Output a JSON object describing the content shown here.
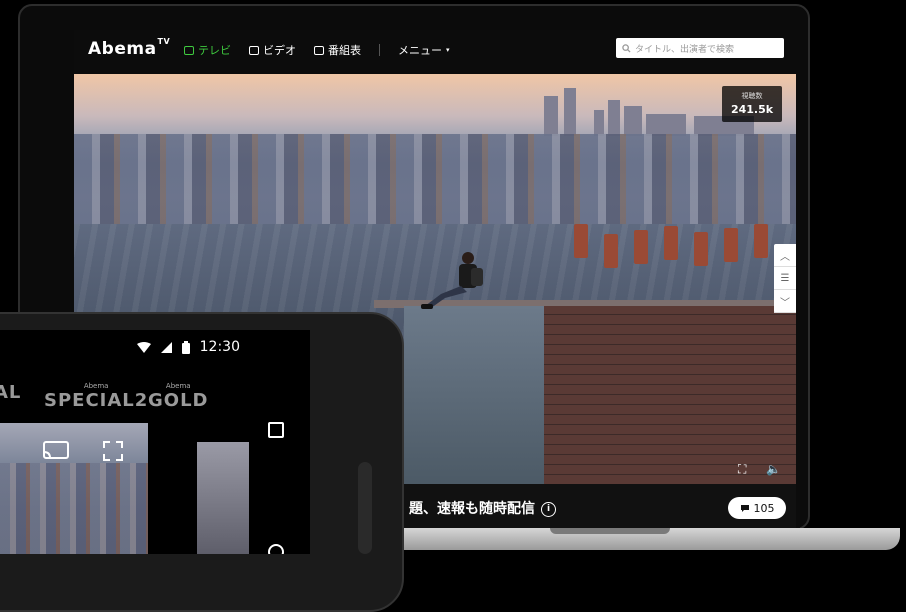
{
  "app": {
    "logo_text": "Abema",
    "logo_sup": "TV"
  },
  "nav": {
    "items": [
      {
        "label": "テレビ",
        "icon": "tv-icon",
        "active": true
      },
      {
        "label": "ビデオ",
        "icon": "film-icon",
        "active": false
      },
      {
        "label": "番組表",
        "icon": "calendar-icon",
        "active": false
      }
    ],
    "menu_label": "メニュー"
  },
  "search": {
    "placeholder": "タイトル、出演者で検索"
  },
  "player": {
    "viewers_label": "視聴数",
    "viewers_count": "241.5k",
    "program_title": "題、速報も随時配信",
    "comment_count": "105"
  },
  "phone": {
    "time": "12:30",
    "channels": [
      {
        "small": "",
        "big": "AL"
      },
      {
        "small": "Abema",
        "big": "SPECIAL2"
      },
      {
        "small": "Abema",
        "big": "GOLD"
      }
    ]
  },
  "colors": {
    "accent": "#3fca3f",
    "background": "#000000"
  }
}
